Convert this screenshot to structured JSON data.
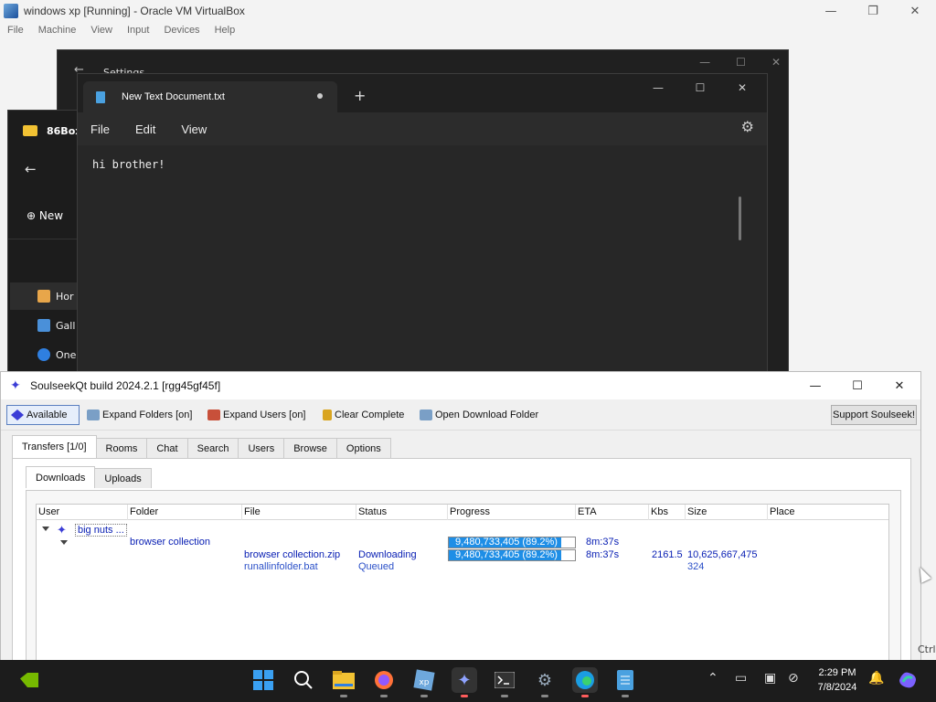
{
  "vbox": {
    "title": "windows xp [Running] - Oracle VM VirtualBox",
    "menu": [
      "File",
      "Machine",
      "View",
      "Input",
      "Devices",
      "Help"
    ]
  },
  "settings_window": {
    "title": "Settings"
  },
  "explorer_window": {
    "title": "86Box",
    "new_label": "New",
    "nav": [
      "Hor",
      "Gall",
      "One"
    ]
  },
  "notepad": {
    "tab_title": "New Text Document.txt",
    "menu": [
      "File",
      "Edit",
      "View"
    ],
    "content": "hi brother!"
  },
  "soulseek": {
    "title": "SoulseekQt build 2024.2.1 [rgg45gf45f]",
    "toolbar": {
      "available": "Available",
      "expand_folders": "Expand Folders [on]",
      "expand_users": "Expand Users [on]",
      "clear_complete": "Clear Complete",
      "open_download_folder": "Open Download Folder",
      "support": "Support Soulseek!"
    },
    "main_tabs": [
      "Transfers [1/0]",
      "Rooms",
      "Chat",
      "Search",
      "Users",
      "Browse",
      "Options"
    ],
    "sub_tabs": [
      "Downloads",
      "Uploads"
    ],
    "columns": [
      "User",
      "Folder",
      "File",
      "Status",
      "Progress",
      "ETA",
      "Kbs",
      "Size",
      "Place"
    ],
    "user": "big nuts",
    "user_suffix": "...",
    "folder": "browser collection",
    "folder_progress": "9,480,733,405 (89.2%)",
    "folder_progress_fraction": 0.892,
    "folder_eta": "8m:37s",
    "files": [
      {
        "file": "browser collection.zip",
        "status": "Downloading",
        "progress": "9,480,733,405 (89.2%)",
        "progress_fraction": 0.892,
        "eta": "8m:37s",
        "kbs": "2161.5",
        "size": "10,625,667,475"
      },
      {
        "file": "runallinfolder.bat",
        "status": "Queued",
        "size": "324"
      }
    ]
  },
  "side_text": "Ctrl",
  "taskbar": {
    "time": "2:29 PM",
    "date": "7/8/2024"
  },
  "colors": {
    "progress_fill": "#1e8ee6",
    "link_blue": "#0a20b4",
    "taskbar_bg": "#1c1c1c"
  }
}
